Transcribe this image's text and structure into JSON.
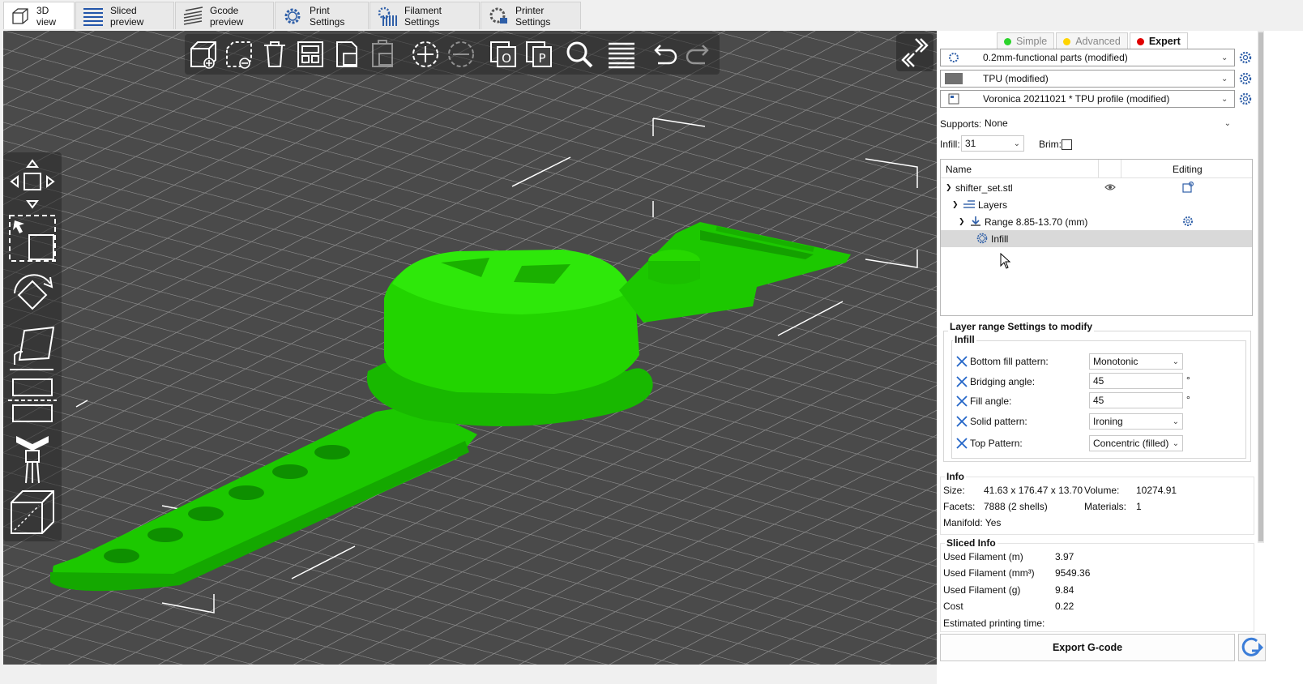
{
  "tabs": [
    {
      "label": "3D view",
      "icon": "cube-icon",
      "active": true
    },
    {
      "label": "Sliced preview",
      "icon": "layers-icon",
      "active": false
    },
    {
      "label": "Gcode preview",
      "icon": "gcode-layers-icon",
      "active": false
    },
    {
      "label": "Print Settings",
      "icon": "gear-icon",
      "active": false
    },
    {
      "label": "Filament Settings",
      "icon": "filament-spool-icon",
      "active": false
    },
    {
      "label": "Printer Settings",
      "icon": "printer-gear-icon",
      "active": false
    }
  ],
  "toolbar": {
    "items": [
      "add-icon",
      "delete-icon",
      "delete-all-icon",
      "arrange-icon",
      "copy-icon",
      "paste-icon",
      "instance-add-icon",
      "instance-remove-icon",
      "split-objects-icon",
      "split-parts-icon",
      "search-icon",
      "layers-editing-icon",
      "undo-icon",
      "redo-icon"
    ]
  },
  "left_tools": [
    "move-icon",
    "select-icon",
    "rotate-icon",
    "scale-icon",
    "place-on-face-icon",
    "cut-icon",
    "paint-supports-icon",
    "seam-painting-icon"
  ],
  "modes": [
    {
      "label": "Simple",
      "color": "#2bd32b",
      "active": false
    },
    {
      "label": "Advanced",
      "color": "#ffd400",
      "active": false
    },
    {
      "label": "Expert",
      "color": "#e00000",
      "active": true
    }
  ],
  "presets": {
    "print": "0.2mm-functional parts (modified)",
    "filament": "TPU (modified)",
    "filament_color": "#707070",
    "printer": "Voronica 20211021 * TPU profile (modified)"
  },
  "supports": {
    "label": "Supports:",
    "value": "None"
  },
  "infill": {
    "label": "Infill:",
    "value": "31"
  },
  "brim": {
    "label": "Brim:",
    "checked": false
  },
  "object_list": {
    "col_name": "Name",
    "col_editing": "Editing",
    "rows": [
      {
        "label": "shifter_set.stl"
      },
      {
        "label": "Layers"
      },
      {
        "label": "Range 8.85-13.70 (mm)"
      },
      {
        "label": "Infill",
        "selected": true
      }
    ]
  },
  "layer_settings": {
    "title": "Layer range Settings to modify",
    "group": "Infill",
    "rows": [
      {
        "label": "Bottom fill pattern:",
        "value": "Monotonic",
        "type": "select",
        "unit": ""
      },
      {
        "label": "Bridging angle:",
        "value": "45",
        "type": "text",
        "unit": "°"
      },
      {
        "label": "Fill angle:",
        "value": "45",
        "type": "text",
        "unit": "°"
      },
      {
        "label": "Solid pattern:",
        "value": "Ironing",
        "type": "select",
        "unit": ""
      },
      {
        "label": "Top Pattern:",
        "value": "Concentric (filled)",
        "type": "select",
        "unit": ""
      }
    ]
  },
  "info": {
    "title": "Info",
    "size_label": "Size:",
    "size": "41.63 x 176.47 x 13.70",
    "volume_label": "Volume:",
    "volume": "10274.91",
    "facets_label": "Facets:",
    "facets": "7888 (2 shells)",
    "materials_label": "Materials:",
    "materials": "1",
    "manifold": "Manifold: Yes"
  },
  "sliced_info": {
    "title": "Sliced Info",
    "rows": [
      {
        "label": "Used Filament (m)",
        "value": "3.97"
      },
      {
        "label": "Used Filament (mm³)",
        "value": "9549.36"
      },
      {
        "label": "Used Filament (g)",
        "value": "9.84"
      },
      {
        "label": "Cost",
        "value": "0.22"
      },
      {
        "label": "Estimated printing time:",
        "value": ""
      }
    ]
  },
  "export_label": "Export G-code",
  "colors": {
    "model": "#22dd00",
    "bed": "#4a4a4a",
    "accent": "#3b7dd8"
  }
}
